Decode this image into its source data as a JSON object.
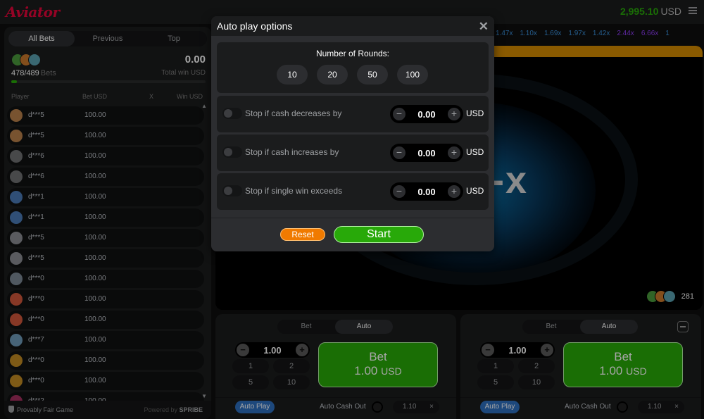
{
  "header": {
    "logo": "Aviator",
    "balance": "2,995.10",
    "currency": "USD"
  },
  "bets_panel": {
    "tabs": [
      "All Bets",
      "Previous",
      "Top"
    ],
    "active_tab": "All Bets",
    "bets_count": "478/489",
    "bets_label": "Bets",
    "total_win": "0.00",
    "total_win_label": "Total win USD",
    "progress": 0.03,
    "columns": {
      "player": "Player",
      "bet": "Bet USD",
      "x": "X",
      "win": "Win USD"
    },
    "rows": [
      {
        "name": "d***5",
        "bet": "100.00",
        "avatar_color": "#b9804a"
      },
      {
        "name": "d***5",
        "bet": "100.00",
        "avatar_color": "#b9804a"
      },
      {
        "name": "d***6",
        "bet": "100.00",
        "avatar_color": "#6f7072"
      },
      {
        "name": "d***6",
        "bet": "100.00",
        "avatar_color": "#6f7072"
      },
      {
        "name": "d***1",
        "bet": "100.00",
        "avatar_color": "#4a7ab5"
      },
      {
        "name": "d***1",
        "bet": "100.00",
        "avatar_color": "#4a7ab5"
      },
      {
        "name": "d***5",
        "bet": "100.00",
        "avatar_color": "#8a8d92"
      },
      {
        "name": "d***5",
        "bet": "100.00",
        "avatar_color": "#8a8d92"
      },
      {
        "name": "d***0",
        "bet": "100.00",
        "avatar_color": "#7c8794"
      },
      {
        "name": "d***0",
        "bet": "100.00",
        "avatar_color": "#d0563b"
      },
      {
        "name": "d***0",
        "bet": "100.00",
        "avatar_color": "#d0563b"
      },
      {
        "name": "d***7",
        "bet": "100.00",
        "avatar_color": "#6d9ab8"
      },
      {
        "name": "d***0",
        "bet": "100.00",
        "avatar_color": "#c28a22"
      },
      {
        "name": "d***0",
        "bet": "100.00",
        "avatar_color": "#c28a22"
      },
      {
        "name": "d***2",
        "bet": "100.00",
        "avatar_color": "#a32e5e"
      }
    ],
    "footer_fair": "Provably Fair Game",
    "footer_powered": "Powered by",
    "footer_brand": "SPRIBE"
  },
  "multipliers": [
    {
      "value": "1.47x",
      "color": "#3a8fd9"
    },
    {
      "value": "1.10x",
      "color": "#3a8fd9"
    },
    {
      "value": "1.69x",
      "color": "#3a8fd9"
    },
    {
      "value": "1.97x",
      "color": "#3a8fd9"
    },
    {
      "value": "1.42x",
      "color": "#3a8fd9"
    },
    {
      "value": "2.44x",
      "color": "#913ef8"
    },
    {
      "value": "6.66x",
      "color": "#913ef8"
    },
    {
      "value": "1",
      "color": "#3a8fd9"
    }
  ],
  "game": {
    "multiplier_text": "-x",
    "players_online": "281"
  },
  "bet_panels": [
    {
      "tabs": [
        "Bet",
        "Auto"
      ],
      "amount": "1.00",
      "presets": [
        "1",
        "2",
        "5",
        "10"
      ],
      "bet_label": "Bet",
      "bet_amount": "1.00",
      "currency": "USD",
      "auto_play": "Auto Play",
      "auto_cashout_label": "Auto Cash Out",
      "auto_cashout_value": "1.10"
    },
    {
      "tabs": [
        "Bet",
        "Auto"
      ],
      "amount": "1.00",
      "presets": [
        "1",
        "2",
        "5",
        "10"
      ],
      "bet_label": "Bet",
      "bet_amount": "1.00",
      "currency": "USD",
      "auto_play": "Auto Play",
      "auto_cashout_label": "Auto Cash Out",
      "auto_cashout_value": "1.10"
    }
  ],
  "modal": {
    "title": "Auto play options",
    "rounds_label": "Number of Rounds:",
    "rounds": [
      "10",
      "20",
      "50",
      "100"
    ],
    "stops": [
      {
        "label": "Stop if cash decreases by",
        "value": "0.00",
        "unit": "USD"
      },
      {
        "label": "Stop if cash increases by",
        "value": "0.00",
        "unit": "USD"
      },
      {
        "label": "Stop if single win exceeds",
        "value": "0.00",
        "unit": "USD"
      }
    ],
    "reset": "Reset",
    "start": "Start"
  },
  "icons": {
    "close": "close-icon",
    "menu": "menu-icon",
    "minus": "minus-icon",
    "plus": "plus-icon",
    "shield": "shield-icon",
    "chevron_up": "chevron-up-icon",
    "chevron_down": "chevron-down-icon"
  }
}
